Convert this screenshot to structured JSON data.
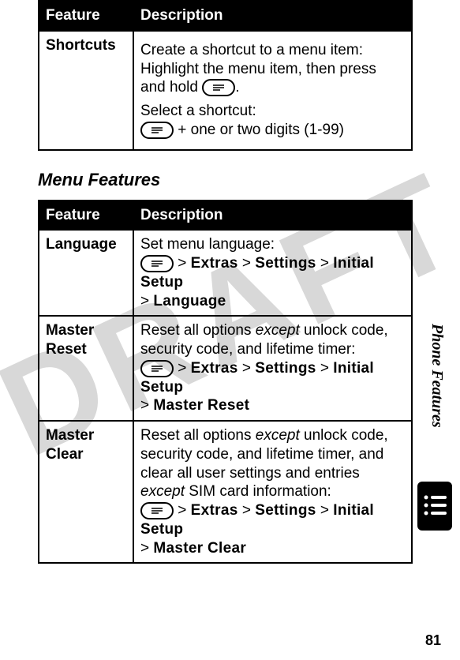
{
  "watermark": "DRAFT",
  "table1": {
    "headers": [
      "Feature",
      "Description"
    ],
    "rows": [
      {
        "feature": "Shortcuts",
        "p1_prefix": "Create a shortcut to a menu item: Highlight the menu item, then press and hold ",
        "p1_suffix": ".",
        "p2_line1": "Select a shortcut:",
        "p2_key_suffix": " + one or two digits (1-99)"
      }
    ]
  },
  "section_heading": "Menu Features",
  "table2": {
    "headers": [
      "Feature",
      "Description"
    ],
    "rows": [
      {
        "feature": "Language",
        "lead": "Set menu language:",
        "path": [
          "Extras",
          "Settings",
          "Initial Setup",
          "Language"
        ]
      },
      {
        "feature": "Master Reset",
        "lead_pre": "Reset all options ",
        "lead_em": "except",
        "lead_post": " unlock code, security code, and lifetime timer:",
        "path": [
          "Extras",
          "Settings",
          "Initial Setup",
          "Master Reset"
        ]
      },
      {
        "feature": "Master Clear",
        "lead_pre": "Reset all options ",
        "lead_em1": "except",
        "lead_mid": " unlock code, security code, and lifetime timer, and clear all user settings and entries ",
        "lead_em2": "except",
        "lead_post": " SIM card information:",
        "path": [
          "Extras",
          "Settings",
          "Initial Setup",
          "Master Clear"
        ]
      }
    ]
  },
  "side_tab": "Phone Features",
  "page_number": "81",
  "sep": ">"
}
